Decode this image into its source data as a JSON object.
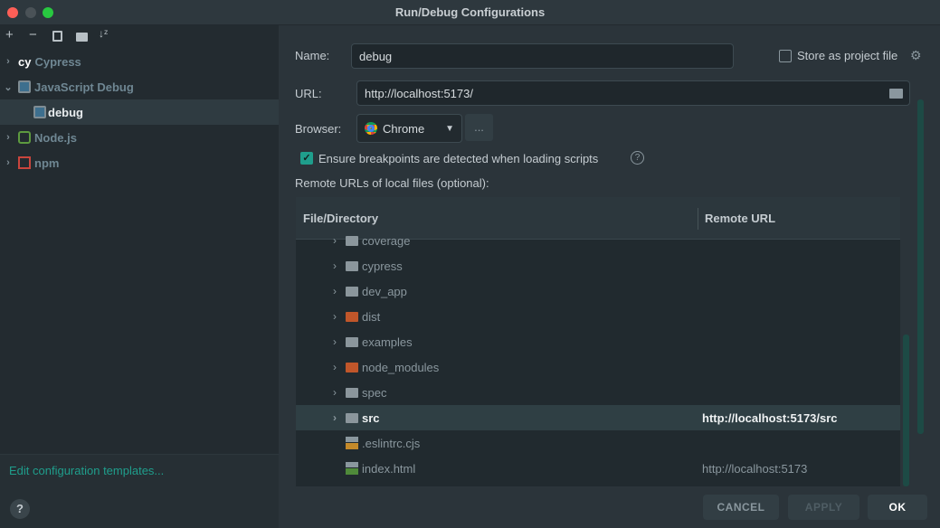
{
  "window": {
    "title": "Run/Debug Configurations"
  },
  "toolbar": {
    "add": "+",
    "remove": "−",
    "copy_icon": "copy-icon",
    "folder_icon": "new-folder-icon",
    "sort_icon": "sort-alpha-icon"
  },
  "tree": [
    {
      "label": "Cypress",
      "icon": "cypress-icon",
      "expanded": false
    },
    {
      "label": "JavaScript Debug",
      "icon": "js-debug-icon",
      "expanded": true
    },
    {
      "label": "debug",
      "icon": "js-debug-icon",
      "selected": true
    },
    {
      "label": "Node.js",
      "icon": "nodejs-icon",
      "expanded": false
    },
    {
      "label": "npm",
      "icon": "npm-icon",
      "expanded": false
    }
  ],
  "edit_templates": "Edit configuration templates...",
  "help": "?",
  "form": {
    "name_label": "Name:",
    "name_value": "debug",
    "store_label": "Store as project file",
    "store_checked": false,
    "url_label": "URL:",
    "url_value": "http://localhost:5173/",
    "browser_label": "Browser:",
    "browser_value": "Chrome",
    "browser_more": "...",
    "ensure_label": "Ensure breakpoints are detected when loading scripts",
    "ensure_checked": true,
    "remote_label": "Remote URLs of local files (optional):"
  },
  "table": {
    "headers": [
      "File/Directory",
      "Remote URL"
    ],
    "rows": [
      {
        "name": "coverage",
        "type": "folder",
        "url": ""
      },
      {
        "name": "cypress",
        "type": "folder",
        "url": ""
      },
      {
        "name": "dev_app",
        "type": "folder",
        "url": ""
      },
      {
        "name": "dist",
        "type": "excluded-folder",
        "url": ""
      },
      {
        "name": "examples",
        "type": "folder",
        "url": ""
      },
      {
        "name": "node_modules",
        "type": "excluded-folder",
        "url": ""
      },
      {
        "name": "spec",
        "type": "folder",
        "url": ""
      },
      {
        "name": "src",
        "type": "folder",
        "url": "http://localhost:5173/src",
        "selected": true
      },
      {
        "name": ".eslintrc.cjs",
        "type": "js-file",
        "url": ""
      },
      {
        "name": "index.html",
        "type": "html-file",
        "url": "http://localhost:5173"
      }
    ]
  },
  "buttons": {
    "cancel": "CANCEL",
    "apply": "APPLY",
    "ok": "OK"
  },
  "colors": {
    "accent": "#1f9e8c",
    "excluded": "#c0562a"
  }
}
